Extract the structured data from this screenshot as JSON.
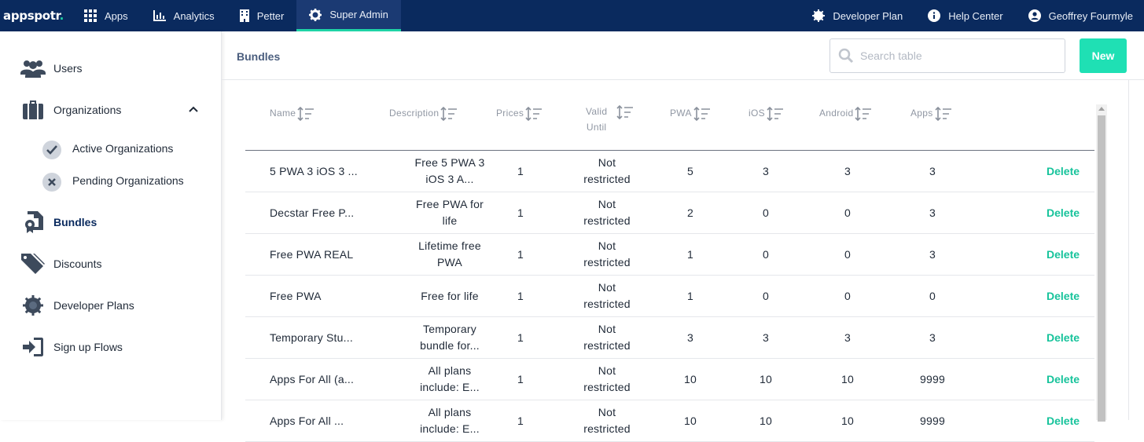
{
  "topbar": {
    "logo": "appspotr",
    "logo_dot": ".",
    "nav": [
      {
        "label": "Apps",
        "icon": "grid-icon"
      },
      {
        "label": "Analytics",
        "icon": "bar-chart-icon"
      },
      {
        "label": "Petter",
        "icon": "building-icon"
      },
      {
        "label": "Super Admin",
        "icon": "gear-icon",
        "active": true
      }
    ],
    "right": [
      {
        "label": "Developer Plan",
        "icon": "badge-icon"
      },
      {
        "label": "Help Center",
        "icon": "info-icon"
      },
      {
        "label": "Geoffrey Fourmyle",
        "icon": "user-circle-icon"
      }
    ]
  },
  "sidebar": {
    "users": "Users",
    "organizations": "Organizations",
    "active_orgs": "Active Organizations",
    "pending_orgs": "Pending Organizations",
    "bundles": "Bundles",
    "discounts": "Discounts",
    "developer_plans": "Developer Plans",
    "signup_flows": "Sign up Flows"
  },
  "main": {
    "title": "Bundles",
    "search_placeholder": "Search table",
    "new_label": "New"
  },
  "table": {
    "headers": [
      "Name",
      "Description",
      "Prices",
      "Valid Until",
      "PWA",
      "iOS",
      "Android",
      "Apps"
    ],
    "header_valid_1": "Valid",
    "header_valid_2": "Until",
    "delete_label": "Delete",
    "rows": [
      {
        "name": "5 PWA 3 iOS 3 ...",
        "desc1": "Free 5 PWA 3",
        "desc2": "iOS 3 A...",
        "price": "1",
        "valid1": "Not",
        "valid2": "restricted",
        "pwa": "5",
        "ios": "3",
        "android": "3",
        "apps": "3"
      },
      {
        "name": "Decstar Free P...",
        "desc1": "Free PWA for",
        "desc2": "life",
        "price": "1",
        "valid1": "Not",
        "valid2": "restricted",
        "pwa": "2",
        "ios": "0",
        "android": "0",
        "apps": "3"
      },
      {
        "name": "Free PWA REAL",
        "desc1": "Lifetime free",
        "desc2": "PWA",
        "price": "1",
        "valid1": "Not",
        "valid2": "restricted",
        "pwa": "1",
        "ios": "0",
        "android": "0",
        "apps": "3"
      },
      {
        "name": "Free PWA",
        "desc1": "Free for life",
        "desc2": "",
        "price": "1",
        "valid1": "Not",
        "valid2": "restricted",
        "pwa": "1",
        "ios": "0",
        "android": "0",
        "apps": "0"
      },
      {
        "name": "Temporary Stu...",
        "desc1": "Temporary",
        "desc2": "bundle for...",
        "price": "1",
        "valid1": "Not",
        "valid2": "restricted",
        "pwa": "3",
        "ios": "3",
        "android": "3",
        "apps": "3"
      },
      {
        "name": "Apps For All (a...",
        "desc1": "All plans",
        "desc2": "include: E...",
        "price": "1",
        "valid1": "Not",
        "valid2": "restricted",
        "pwa": "10",
        "ios": "10",
        "android": "10",
        "apps": "9999"
      },
      {
        "name": "Apps For All ...",
        "desc1": "All plans",
        "desc2": "include: E...",
        "price": "1",
        "valid1": "Not",
        "valid2": "restricted",
        "pwa": "10",
        "ios": "10",
        "android": "10",
        "apps": "9999"
      }
    ]
  }
}
